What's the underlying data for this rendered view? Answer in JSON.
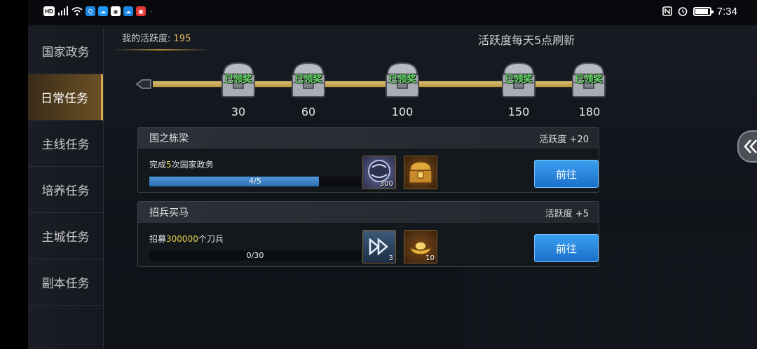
{
  "status_bar": {
    "time": "7:34",
    "left_icons": [
      "hd-icon",
      "signal-4g-icon",
      "wifi-icon",
      "search-app-icon",
      "cloud-app-icon",
      "camera-app-icon",
      "cloud2-app-icon",
      "red-app-icon",
      "more-dots-icon"
    ],
    "right_icons": [
      "nfc-icon",
      "alarm-icon",
      "battery-icon"
    ]
  },
  "sidebar": {
    "items": [
      {
        "label": "国家政务",
        "active": false
      },
      {
        "label": "日常任务",
        "active": true
      },
      {
        "label": "主线任务",
        "active": false
      },
      {
        "label": "培养任务",
        "active": false
      },
      {
        "label": "主城任务",
        "active": false
      },
      {
        "label": "副本任务",
        "active": false
      }
    ]
  },
  "header": {
    "activity_label": "我的活跃度:",
    "activity_value": "195",
    "refresh_note": "活跃度每天5点刷新"
  },
  "milestones": [
    {
      "value": "30",
      "status": "已领奖"
    },
    {
      "value": "60",
      "status": "已领奖"
    },
    {
      "value": "100",
      "status": "已领奖"
    },
    {
      "value": "150",
      "status": "已领奖"
    },
    {
      "value": "180",
      "status": "已领奖"
    }
  ],
  "tasks": [
    {
      "title": "国之栋梁",
      "points": "活跃度 +20",
      "desc_prefix": "完成",
      "desc_highlight": "5",
      "desc_suffix": "次国家政务",
      "progress_text": "4/5",
      "progress": 0.8,
      "rewards": [
        {
          "icon": "purple-orb-icon",
          "count": "300"
        },
        {
          "icon": "treasure-chest-icon",
          "count": ""
        }
      ],
      "button": "前往"
    },
    {
      "title": "招兵买马",
      "points": "活跃度 +5",
      "desc_prefix": "招募",
      "desc_highlight": "300000",
      "desc_suffix": "个刀兵",
      "progress_text": "0/30",
      "progress": 0,
      "rewards": [
        {
          "icon": "speedup-arrows-icon",
          "count": "3"
        },
        {
          "icon": "gold-ingot-icon",
          "count": "10"
        }
      ],
      "button": "前往"
    }
  ],
  "colors": {
    "accent_gold": "#e6b85a",
    "progress_blue": "#2e6fb0",
    "claimed_green": "#6be06b",
    "button_blue": "#1b6fc8"
  }
}
